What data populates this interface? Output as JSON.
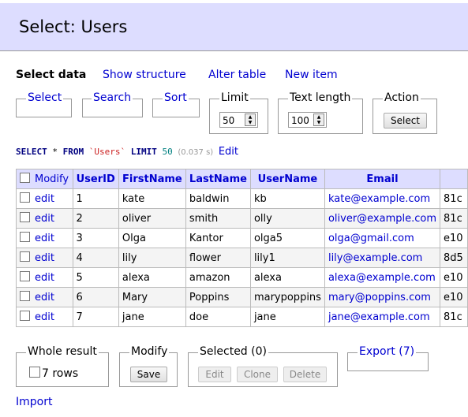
{
  "title": "Select: Users",
  "nav": {
    "select_data": "Select data",
    "show_structure": "Show structure",
    "alter_table": "Alter table",
    "new_item": "New item"
  },
  "filters": {
    "select": "Select",
    "search": "Search",
    "sort": "Sort",
    "limit_label": "Limit",
    "limit_value": "50",
    "text_length_label": "Text length",
    "text_length_value": "100",
    "action_label": "Action",
    "action_button": "Select"
  },
  "query": {
    "select": "SELECT",
    "star": "*",
    "from": "FROM",
    "table": "`Users`",
    "limit": "LIMIT",
    "limit_num": "50",
    "time": "(0.037 s)",
    "edit": "Edit"
  },
  "table": {
    "modify_header": "Modify",
    "columns": [
      "UserID",
      "FirstName",
      "LastName",
      "UserName",
      "Email"
    ],
    "edit_label": "edit",
    "rows": [
      {
        "id": "1",
        "first": "kate",
        "last": "baldwin",
        "user": "kb",
        "email": "kate@example.com",
        "extra": "81c"
      },
      {
        "id": "2",
        "first": "oliver",
        "last": "smith",
        "user": "olly",
        "email": "oliver@example.com",
        "extra": "81c"
      },
      {
        "id": "3",
        "first": "Olga",
        "last": "Kantor",
        "user": "olga5",
        "email": "olga@gmail.com",
        "extra": "e10"
      },
      {
        "id": "4",
        "first": "lily",
        "last": "flower",
        "user": "lily1",
        "email": "lily@example.com",
        "extra": "8d5"
      },
      {
        "id": "5",
        "first": "alexa",
        "last": "amazon",
        "user": "alexa",
        "email": "alexa@example.com",
        "extra": "e10"
      },
      {
        "id": "6",
        "first": "Mary",
        "last": "Poppins",
        "user": "marypoppins",
        "email": "mary@poppins.com",
        "extra": "e10"
      },
      {
        "id": "7",
        "first": "jane",
        "last": "doe",
        "user": "jane",
        "email": "jane@example.com",
        "extra": "81c"
      }
    ]
  },
  "footer": {
    "whole_result": "Whole result",
    "rows_label": "7 rows",
    "modify": "Modify",
    "save": "Save",
    "selected": "Selected (0)",
    "edit": "Edit",
    "clone": "Clone",
    "delete": "Delete",
    "export": "Export (7)",
    "import": "Import"
  }
}
